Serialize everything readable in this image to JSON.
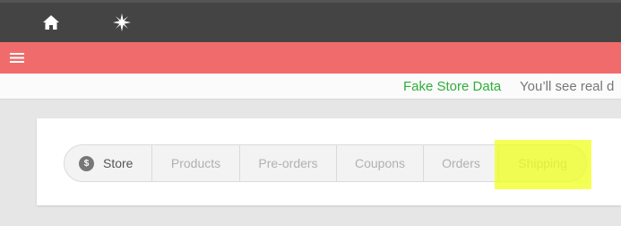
{
  "topbar": {
    "icons": [
      {
        "name": "home-icon"
      },
      {
        "name": "compass-star-icon"
      }
    ]
  },
  "navbar": {
    "menu_icon": "hamburger-menu-icon",
    "accent_color": "#f06c6c"
  },
  "notice": {
    "highlight": "Fake Store Data",
    "text": "You’ll see real d",
    "highlight_color": "#2fae3a"
  },
  "tabs": {
    "items": [
      {
        "label": "Store",
        "icon": "dollar-coin-icon",
        "icon_glyph": "$"
      },
      {
        "label": "Products"
      },
      {
        "label": "Pre-orders"
      },
      {
        "label": "Coupons"
      },
      {
        "label": "Orders"
      },
      {
        "label": "Shipping"
      }
    ],
    "active": "Store",
    "highlighted": "Shipping"
  }
}
